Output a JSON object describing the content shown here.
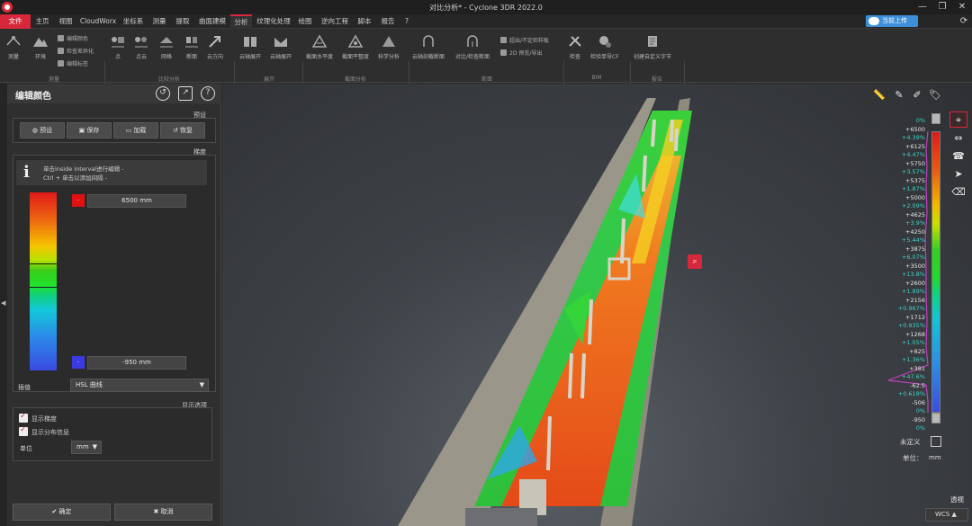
{
  "window": {
    "title": "对比分析* - Cyclone 3DR 2022.0",
    "controls": [
      "—",
      "❐",
      "✕"
    ]
  },
  "menu": {
    "items": [
      "文件",
      "主页",
      "视图",
      "CloudWorx",
      "坐标系",
      "测量",
      "提取",
      "曲面建模",
      "分析",
      "纹理化处理",
      "绘图",
      "逆向工程",
      "脚本",
      "报告",
      "?"
    ],
    "active": "分析",
    "cloud_button": "当前上传"
  },
  "ribbon": {
    "groups": [
      "测量",
      "比较分析",
      "展开",
      "截面分析",
      "断面",
      "BIM",
      "报告"
    ],
    "items": [
      "测量",
      "环境",
      "点",
      "点云",
      "网格",
      "断面",
      "云方向",
      "云轴展开",
      "云轴展开",
      "截面水平度",
      "截面平整度",
      "科学分析",
      "云轴剖截断面",
      "对比/检查断面",
      "检查",
      "检验单导CF",
      "创建自定义字节"
    ],
    "small_items": [
      "编辑颜色",
      "检查差异化",
      "编辑标签",
      "超出/不定检样板",
      "2D 预览/导出"
    ]
  },
  "panel": {
    "title": "编辑颜色",
    "presets_label": "预设",
    "preset_buttons": [
      "预设",
      "保存",
      "加载",
      "恢复"
    ],
    "gradient_label": "梯度",
    "info_line1": "单击inside interval进行编辑 -",
    "info_line2": "Ctrl + 单击以添加间隔 -",
    "max_value": "6500 mm",
    "min_value": "-950 mm",
    "interp_label": "插值",
    "interp_value": "HSL 曲线",
    "display_options_label": "显示选项",
    "show_gradient": "显示梯度",
    "show_distribution": "显示分布信息",
    "unit_label": "单位",
    "unit_value": "mm",
    "ok_button": "确定",
    "cancel_button": "取消"
  },
  "scale": {
    "labels": [
      {
        "t": "0%",
        "c": "c"
      },
      {
        "t": "+6500",
        "c": "w"
      },
      {
        "t": "+4.39%",
        "c": "c"
      },
      {
        "t": "+6125",
        "c": "w"
      },
      {
        "t": "+4.47%",
        "c": "c"
      },
      {
        "t": "+5750",
        "c": "w"
      },
      {
        "t": "+3.57%",
        "c": "c"
      },
      {
        "t": "+5375",
        "c": "w"
      },
      {
        "t": "+1.87%",
        "c": "c"
      },
      {
        "t": "+5000",
        "c": "w"
      },
      {
        "t": "+2.09%",
        "c": "c"
      },
      {
        "t": "+4625",
        "c": "w"
      },
      {
        "t": "+3.9%",
        "c": "c"
      },
      {
        "t": "+4250",
        "c": "w"
      },
      {
        "t": "+5.44%",
        "c": "c"
      },
      {
        "t": "+3875",
        "c": "w"
      },
      {
        "t": "+6.07%",
        "c": "c"
      },
      {
        "t": "+3500",
        "c": "w"
      },
      {
        "t": "+13.8%",
        "c": "c"
      },
      {
        "t": "+2600",
        "c": "w"
      },
      {
        "t": "+1.89%",
        "c": "c"
      },
      {
        "t": "+2156",
        "c": "w"
      },
      {
        "t": "+0.967%",
        "c": "c"
      },
      {
        "t": "+1712",
        "c": "w"
      },
      {
        "t": "+0.935%",
        "c": "c"
      },
      {
        "t": "+1268",
        "c": "w"
      },
      {
        "t": "+1.05%",
        "c": "c"
      },
      {
        "t": "+825",
        "c": "w"
      },
      {
        "t": "+1.36%",
        "c": "c"
      },
      {
        "t": "+381",
        "c": "w"
      },
      {
        "t": "+47.6%",
        "c": "c"
      },
      {
        "t": "-62.5",
        "c": "w"
      },
      {
        "t": "+0.618%",
        "c": "c"
      },
      {
        "t": "-506",
        "c": "w"
      },
      {
        "t": "0%",
        "c": "c"
      },
      {
        "t": "-950",
        "c": "w"
      },
      {
        "t": "0%",
        "c": "c"
      }
    ],
    "undefined_label": "未定义",
    "unit_label": "单位：",
    "unit_value": "mm"
  },
  "viewport": {
    "perspective_label": "透视",
    "coord_system": "WCS"
  },
  "colors": {
    "accent": "#d7283b",
    "cloud": "#3d8fd9"
  }
}
